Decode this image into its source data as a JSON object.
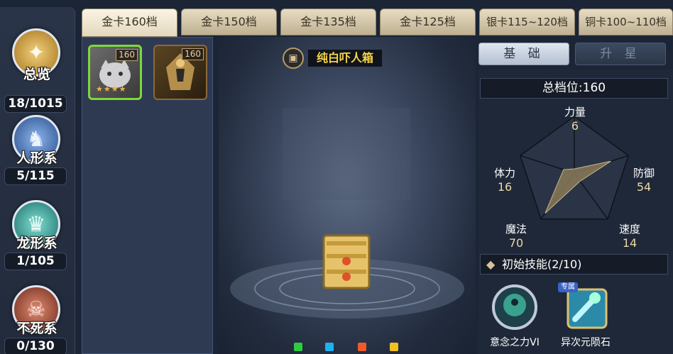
{
  "categories": [
    {
      "name": "总览",
      "count": "18/1015",
      "icon": "overview-emblem-icon",
      "color": "#b8892f"
    },
    {
      "name": "人形系",
      "count": "5/115",
      "icon": "humanoid-emblem-icon",
      "color": "#3f71b8"
    },
    {
      "name": "龙形系",
      "count": "1/105",
      "icon": "dragon-emblem-icon",
      "color": "#2d9a92"
    },
    {
      "name": "不死系",
      "count": "0/130",
      "icon": "undead-emblem-icon",
      "color": "#8a3a2a"
    }
  ],
  "tabs": [
    "金卡160档",
    "金卡150档",
    "金卡135档",
    "金卡125档",
    "银卡115~120档",
    "铜卡100~110档"
  ],
  "active_tab": 0,
  "cards": [
    {
      "level": "160",
      "stars": "★★★★",
      "selected": true
    },
    {
      "level": "160",
      "stars": "",
      "selected": false
    }
  ],
  "monster": {
    "name": "纯白吓人箱",
    "icon": "chest-icon"
  },
  "buttons": {
    "basic": "基 础",
    "upgrade": "升 星"
  },
  "total_label": "总档位:160",
  "stats": [
    {
      "label": "力量",
      "value": "6"
    },
    {
      "label": "防御",
      "value": "54"
    },
    {
      "label": "速度",
      "value": "14"
    },
    {
      "label": "魔法",
      "value": "70"
    },
    {
      "label": "体力",
      "value": "16"
    }
  ],
  "stat_max": 80,
  "skills_header": "初始技能(2/10)",
  "skills": [
    {
      "name": "意念之力VI",
      "icon": "mind-force-icon"
    },
    {
      "name": "异次元陨石",
      "icon": "meteor-icon",
      "badge": "专属"
    }
  ],
  "gem_colors": [
    "#2ecc40",
    "#1fb2f0",
    "#f05a2a",
    "#f0c020"
  ]
}
